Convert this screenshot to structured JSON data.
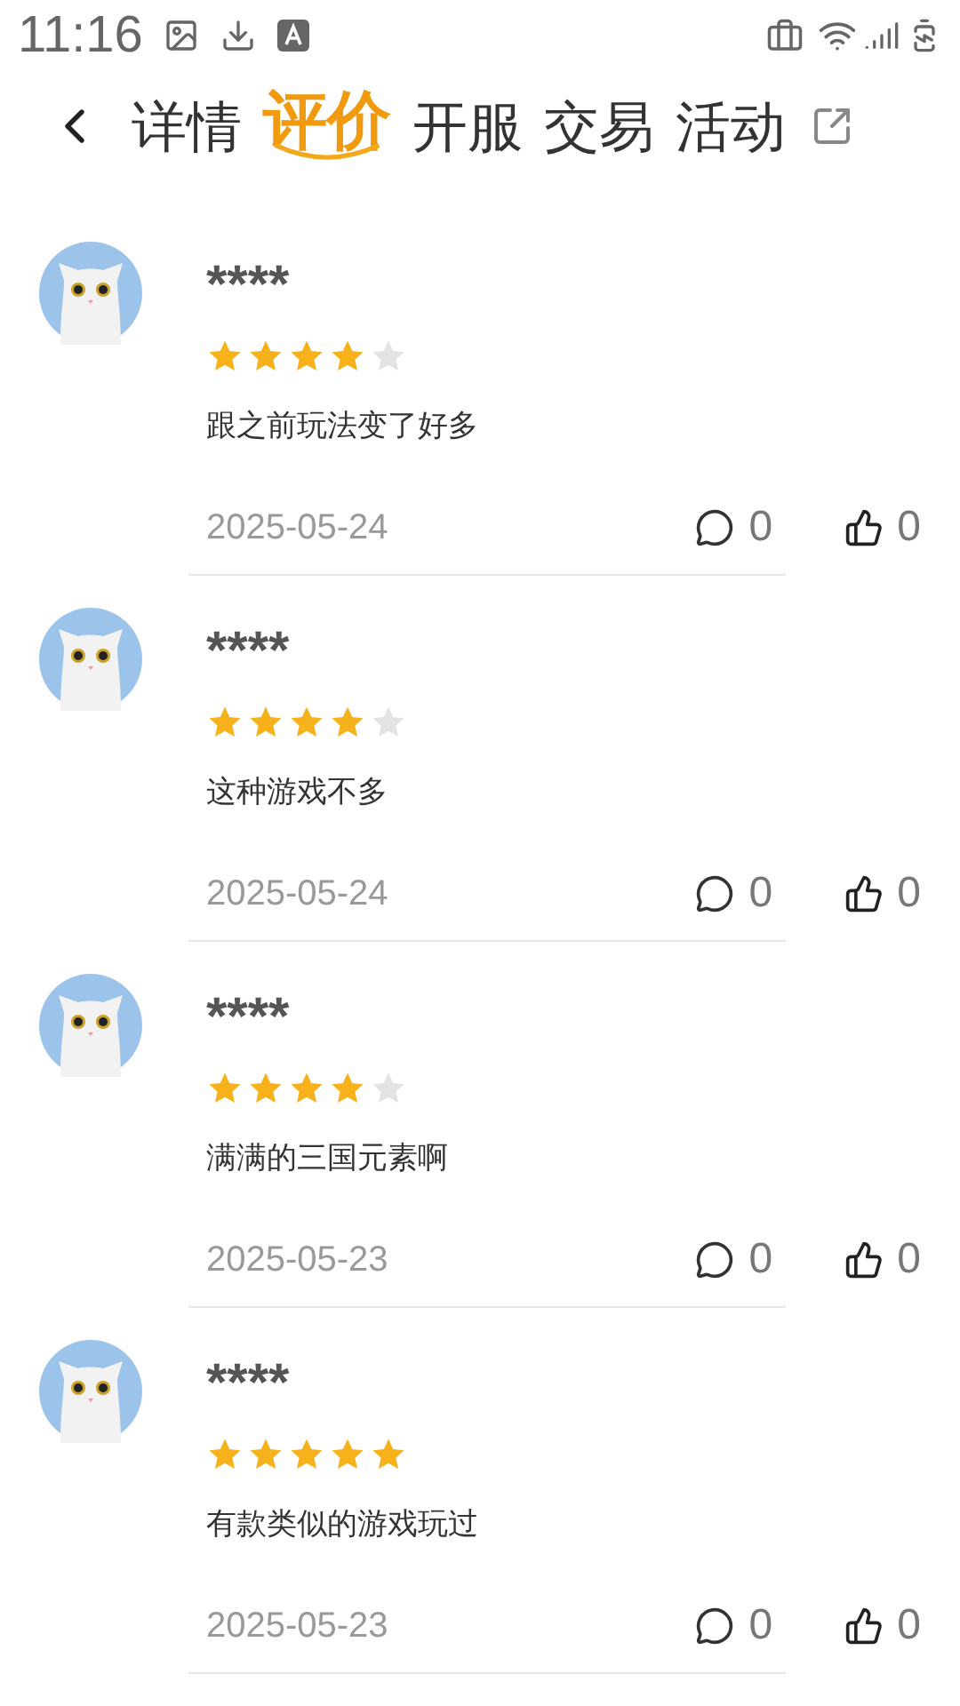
{
  "status_bar": {
    "time": "11:16"
  },
  "tabs": [
    {
      "label": "详情",
      "selected": false
    },
    {
      "label": "评价",
      "selected": true
    },
    {
      "label": "开服",
      "selected": false
    },
    {
      "label": "交易",
      "selected": false
    },
    {
      "label": "活动",
      "selected": false
    }
  ],
  "reviews": [
    {
      "name": "****",
      "stars": 4,
      "text": "跟之前玩法变了好多",
      "date": "2025-05-24",
      "replies": "0",
      "likes": "0"
    },
    {
      "name": "****",
      "stars": 4,
      "text": "这种游戏不多",
      "date": "2025-05-24",
      "replies": "0",
      "likes": "0"
    },
    {
      "name": "****",
      "stars": 4,
      "text": "满满的三国元素啊",
      "date": "2025-05-23",
      "replies": "0",
      "likes": "0"
    },
    {
      "name": "****",
      "stars": 5,
      "text": "有款类似的游戏玩过",
      "date": "2025-05-23",
      "replies": "0",
      "likes": "0"
    }
  ]
}
